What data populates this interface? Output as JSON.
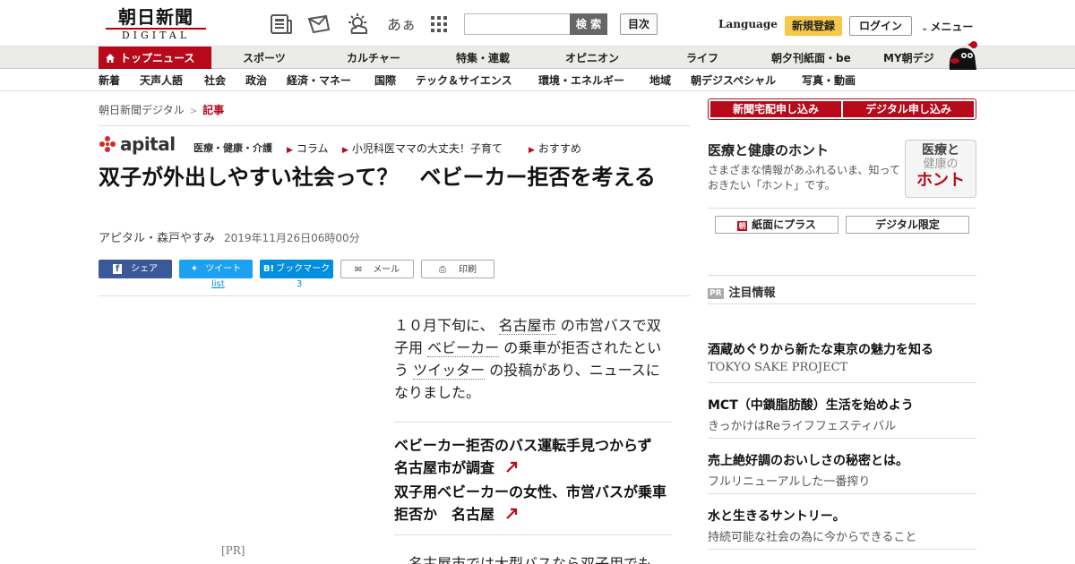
{
  "header": {
    "logo_ja": "朝日新聞",
    "logo_en": "DIGITAL",
    "search_placeholder": "",
    "search_button": "検 索",
    "toc_button": "目次",
    "language": "Language",
    "signup": "新規登録",
    "login": "ログイン",
    "menu": "メニュー",
    "font_icon_text": "あぁ"
  },
  "nav_main": [
    "トップニュース",
    "スポーツ",
    "カルチャー",
    "特集・連載",
    "オピニオン",
    "ライフ",
    "朝夕刊紙面・be",
    "MY朝デジ"
  ],
  "nav_sub": [
    "新着",
    "天声人語",
    "社会",
    "政治",
    "経済・マネー",
    "国際",
    "テック＆サイエンス",
    "環境・エネルギー",
    "地域",
    "朝デジスペシャル",
    "写真・動画"
  ],
  "breadcrumb": {
    "home": "朝日新聞デジタル",
    "sep": ">",
    "current": "記事"
  },
  "apital": {
    "word": "apital",
    "sub": "医療・健康・介護",
    "links": [
      "コラム",
      "小児科医ママの大丈夫！子育て",
      "おすすめ"
    ]
  },
  "article": {
    "headline": "双子が外出しやすい社会って？　ベビーカー拒否を考える",
    "author": "アピタル・森戸やすみ",
    "date": "2019年11月26日06時00分",
    "para1_a": "１０月下旬に、",
    "para1_kw1": "名古屋市",
    "para1_b": "の市営バスで双子用",
    "para1_kw2": "ベビーカー",
    "para1_c": "の乗車が拒否されたという",
    "para1_kw3": "ツイッター",
    "para1_d": "の投稿があり、ニュースになりました。",
    "related": [
      "ベビーカー拒否のバス運転手見つからず　名古屋市が調査",
      "双子用ベビーカーの女性、市営バスが乗車拒否か　名古屋"
    ],
    "para2_kw": "名古屋市",
    "para2": "では大型バスなら双子用でも",
    "pr_tag": "[PR]"
  },
  "share": {
    "facebook": "シェア",
    "twitter": "ツイート",
    "hatena": "ブックマーク",
    "mail": "メール",
    "print": "印刷",
    "twitter_count": "list",
    "hatena_count": "3"
  },
  "sidebar": {
    "subscribe_paper": "新聞宅配申し込み",
    "subscribe_digital": "デジタル申し込み",
    "honto_title": "医療と健康のホント",
    "honto_desc": "さまざまな情報があふれるいま、知っておきたい「ホント」です。",
    "honto_logo_1": "医療と",
    "honto_logo_2": "健康の",
    "honto_logo_3": "ホント",
    "plus_paper": "紙面にプラス",
    "plus_icon": "朝",
    "digital_only": "デジタル限定",
    "pr_badge": "PR",
    "pr_head": "注目情報",
    "ads": [
      {
        "title": "酒蔵めぐりから新たな東京の魅力を知る",
        "sub": "TOKYO SAKE PROJECT"
      },
      {
        "title": "MCT（中鎖脂肪酸）生活を始めよう",
        "sub": "きっかけはReライフフェスティバル"
      },
      {
        "title": "売上絶好調のおいしさの秘密とは。",
        "sub": "フルリニューアルした一番搾り"
      },
      {
        "title": "水と生きるサントリー。",
        "sub": "持続可能な社会の為に今からできること"
      }
    ]
  },
  "colors": {
    "brand_red": "#b8091a",
    "signup_yellow": "#f5c84a",
    "facebook": "#3b5998",
    "twitter": "#1da1f2",
    "hatena": "#008fde"
  }
}
